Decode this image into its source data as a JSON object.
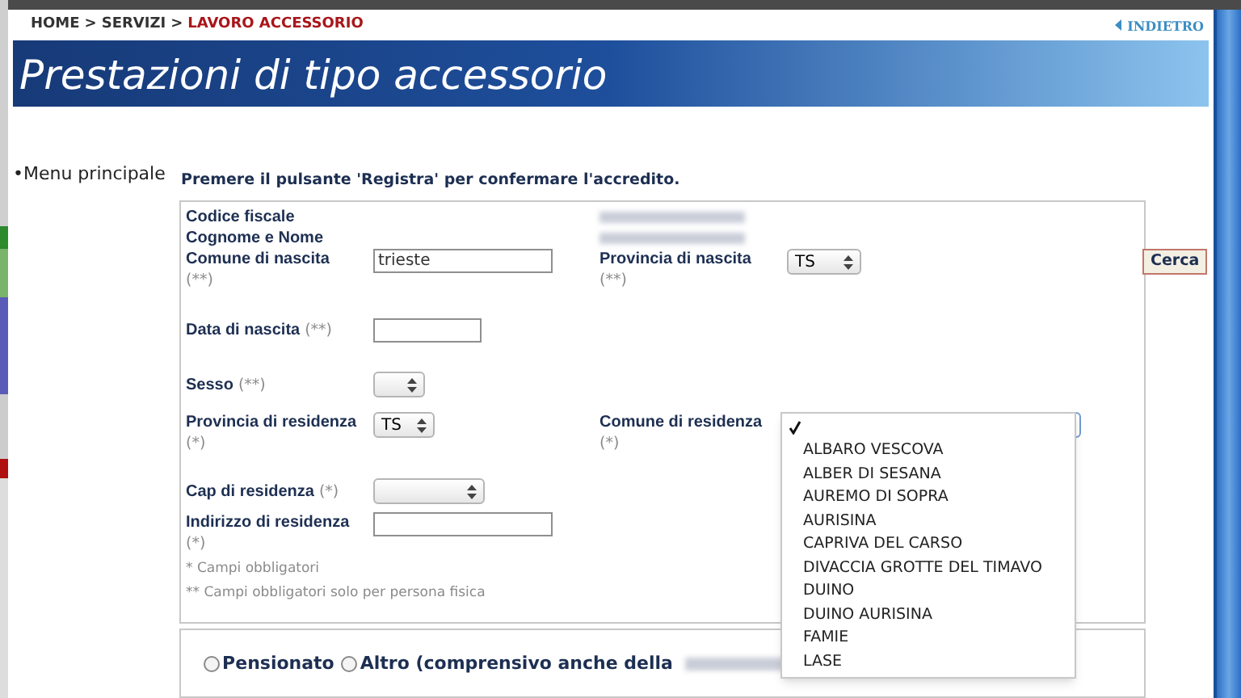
{
  "breadcrumb": {
    "separator": ">",
    "items": [
      {
        "label": "HOME",
        "current": false
      },
      {
        "label": "SERVIZI",
        "current": false
      },
      {
        "label": "LAVORO ACCESSORIO",
        "current": true
      }
    ]
  },
  "back_link": {
    "label": "INDIETRO"
  },
  "banner": {
    "title": "Prestazioni di tipo accessorio"
  },
  "sidebar": {
    "items": [
      {
        "label": "•Menu principale"
      }
    ]
  },
  "instruction": "Premere il pulsante 'Registra' per confermare l'accredito.",
  "form": {
    "rows": [
      {
        "fields": [
          {
            "kind": "readonly",
            "label": "Codice fiscale"
          }
        ]
      },
      {
        "fields": [
          {
            "kind": "readonly",
            "label": "Cognome e Nome"
          }
        ]
      },
      {
        "fields": [
          {
            "kind": "text",
            "label": "Comune di nascita",
            "hint": "(**)",
            "hint_inline": false,
            "value": "trieste"
          },
          {
            "kind": "select",
            "label": "Provincia di nascita",
            "hint": "(**)",
            "hint_inline": false,
            "value": "TS",
            "open": false
          },
          {
            "kind": "button",
            "label": "Cerca"
          }
        ]
      },
      {
        "fields": [
          {
            "kind": "text",
            "label": "Data di nascita",
            "hint": "(**)",
            "hint_inline": true
          }
        ]
      },
      {
        "fields": [
          {
            "kind": "select",
            "label": "Sesso",
            "hint": "(**)",
            "hint_inline": true,
            "open": false
          }
        ]
      },
      {
        "fields": [
          {
            "kind": "select",
            "label": "Provincia di residenza",
            "hint": "(*)",
            "hint_inline": false,
            "value": "TS",
            "open": false
          },
          {
            "kind": "select",
            "label": "Comune di residenza",
            "hint": "(*)",
            "hint_inline": false,
            "open": true,
            "blank_selected": true,
            "options": [
              {
                "label": "ALBARO VESCOVA",
                "selected": false
              },
              {
                "label": "ALBER DI SESANA",
                "selected": false
              },
              {
                "label": "AUREMO DI SOPRA",
                "selected": false
              },
              {
                "label": "AURISINA",
                "selected": false
              },
              {
                "label": "CAPRIVA DEL CARSO",
                "selected": false
              },
              {
                "label": "DIVACCIA GROTTE DEL TIMAVO",
                "selected": false
              },
              {
                "label": "DUINO",
                "selected": false
              },
              {
                "label": "DUINO AURISINA",
                "selected": false
              },
              {
                "label": "FAMIE",
                "selected": false
              },
              {
                "label": "LASE",
                "selected": false
              }
            ]
          }
        ]
      },
      {
        "fields": [
          {
            "kind": "select",
            "label": "Cap di residenza",
            "hint": "(*)",
            "hint_inline": true,
            "open": false
          }
        ]
      },
      {
        "fields": [
          {
            "kind": "text",
            "label": "Indirizzo di residenza",
            "hint": "(*)",
            "hint_inline": false
          }
        ]
      }
    ],
    "notes": [
      "* Campi obbligatori",
      "** Campi obbligatori solo per persona fisica"
    ]
  },
  "radio_group": {
    "options": [
      {
        "label": "Pensionato",
        "selected": false
      },
      {
        "label": "Altro (comprensivo anche della",
        "selected": false
      }
    ]
  }
}
